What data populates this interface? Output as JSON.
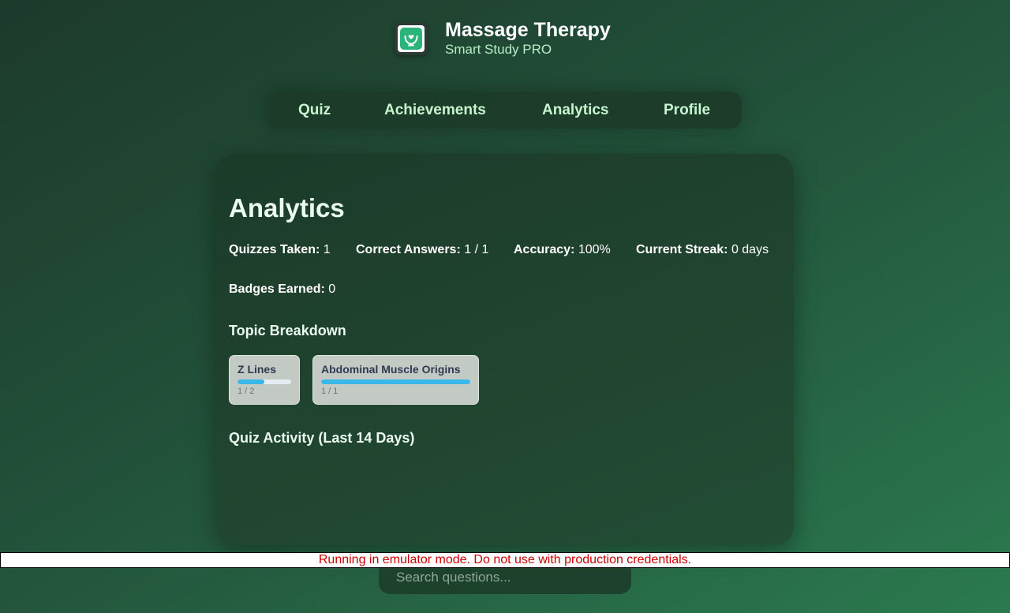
{
  "app": {
    "title": "Massage Therapy",
    "subtitle": "Smart Study PRO",
    "logo_icon": "hands-heart-icon"
  },
  "nav": {
    "tabs": [
      {
        "label": "Quiz"
      },
      {
        "label": "Achievements"
      },
      {
        "label": "Analytics"
      },
      {
        "label": "Profile"
      }
    ]
  },
  "analytics": {
    "title": "Analytics",
    "stats": {
      "quizzes_label": "Quizzes Taken:",
      "quizzes_value": "1",
      "correct_label": "Correct Answers:",
      "correct_value": "1 / 1",
      "accuracy_label": "Accuracy:",
      "accuracy_value": "100%",
      "streak_label": "Current Streak:",
      "streak_value": "0 days",
      "badges_label": "Badges Earned:",
      "badges_value": "0"
    },
    "topic_title": "Topic Breakdown",
    "topics": [
      {
        "name": "Z Lines",
        "count": "1 / 2",
        "progress": 0.5
      },
      {
        "name": "Abdominal Muscle Origins",
        "count": "1 / 1",
        "progress": 1.0
      }
    ],
    "activity_title": "Quiz Activity (Last 14 Days)"
  },
  "search": {
    "placeholder": "Search questions...",
    "value": ""
  },
  "banner": {
    "text": "Running in emulator mode. Do not use with production credentials."
  },
  "colors": {
    "accent": "#2ab47a",
    "progress": "#39b7e8",
    "warning_text": "#cc0000"
  }
}
